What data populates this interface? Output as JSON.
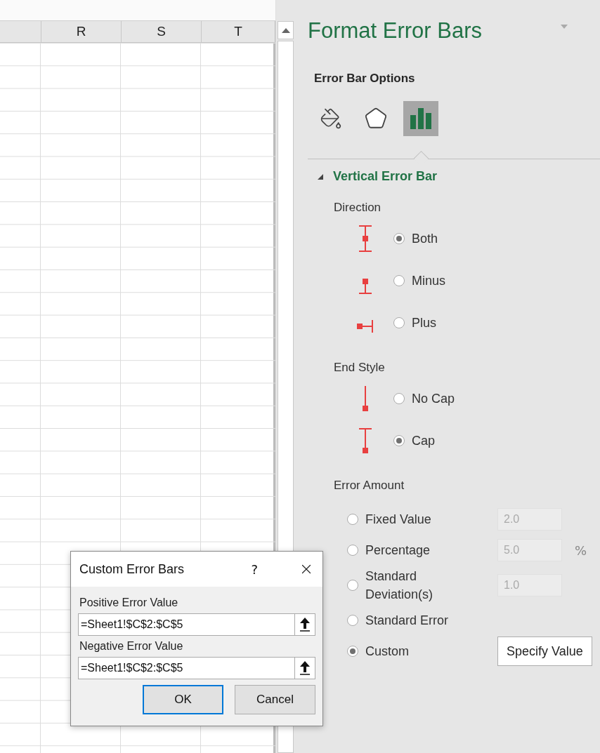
{
  "spreadsheet": {
    "columns": [
      "R",
      "S",
      "T"
    ]
  },
  "panel": {
    "title": "Format Error Bars",
    "subtitle": "Error Bar Options",
    "tabs": [
      {
        "kind": "fill",
        "selected": false
      },
      {
        "kind": "effects",
        "selected": false
      },
      {
        "kind": "options",
        "selected": true
      }
    ],
    "section": {
      "title": "Vertical Error Bar",
      "expanded": true,
      "direction": {
        "label": "Direction",
        "options": [
          {
            "kind": "both",
            "label": "Both",
            "selected": true
          },
          {
            "kind": "minus",
            "label": "Minus",
            "selected": false
          },
          {
            "kind": "plus",
            "label": "Plus",
            "selected": false
          }
        ]
      },
      "end_style": {
        "label": "End Style",
        "options": [
          {
            "kind": "no_cap",
            "label": "No Cap",
            "selected": false
          },
          {
            "kind": "cap",
            "label": "Cap",
            "selected": true
          }
        ]
      },
      "error_amount": {
        "label": "Error Amount",
        "options": [
          {
            "label": "Fixed Value",
            "selected": false,
            "value": "2.0",
            "disabled": true
          },
          {
            "label": "Percentage",
            "selected": false,
            "value": "5.0",
            "unit": "%",
            "disabled": true
          },
          {
            "label": "Standard Deviation(s)",
            "selected": false,
            "value": "1.0",
            "disabled": true
          },
          {
            "label": "Standard Error",
            "selected": false
          },
          {
            "label": "Custom",
            "selected": true,
            "button": "Specify Value"
          }
        ]
      }
    }
  },
  "dialog": {
    "title": "Custom Error Bars",
    "help": "?",
    "fields": [
      {
        "label": "Positive Error Value",
        "value": "=Sheet1!$C$2:$C$5"
      },
      {
        "label": "Negative Error Value",
        "value": "=Sheet1!$C$2:$C$5"
      }
    ],
    "buttons": [
      {
        "label": "OK",
        "default": true
      },
      {
        "label": "Cancel",
        "default": false
      }
    ]
  }
}
